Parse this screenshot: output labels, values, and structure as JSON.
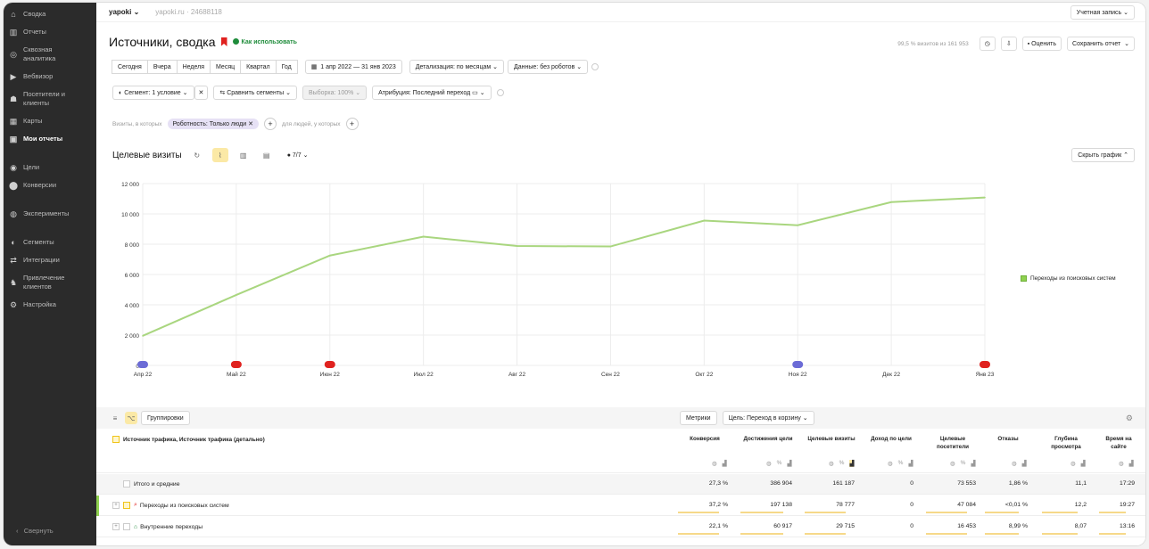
{
  "sidebar": {
    "items": [
      {
        "icon": "home-icon",
        "glyph": "⌂",
        "label": "Сводка"
      },
      {
        "icon": "reports-icon",
        "glyph": "▥",
        "label": "Отчеты"
      },
      {
        "icon": "endtoend-analytics-icon",
        "glyph": "◎",
        "label": "Сквозная аналитика"
      },
      {
        "icon": "webvisor-icon",
        "glyph": "▶",
        "label": "Вебвизор"
      },
      {
        "icon": "visitors-icon",
        "glyph": "☗",
        "label": "Посетители и клиенты"
      },
      {
        "icon": "maps-icon",
        "glyph": "▦",
        "label": "Карты"
      },
      {
        "icon": "my-reports-icon",
        "glyph": "▣",
        "label": "Мои отчеты"
      }
    ],
    "items2": [
      {
        "icon": "goals-icon",
        "glyph": "◉",
        "label": "Цели"
      },
      {
        "icon": "conversions-icon",
        "glyph": "⬤",
        "label": "Конверсии"
      }
    ],
    "items3": [
      {
        "icon": "experiments-icon",
        "glyph": "◍",
        "label": "Эксперименты"
      }
    ],
    "items4": [
      {
        "icon": "segments-icon",
        "glyph": "◐",
        "label": "Сегменты"
      },
      {
        "icon": "integrations-icon",
        "glyph": "⇄",
        "label": "Интеграции"
      },
      {
        "icon": "attract-clients-icon",
        "glyph": "♞",
        "label": "Привлечение клиентов"
      },
      {
        "icon": "settings-icon",
        "glyph": "⚙",
        "label": "Настройка"
      }
    ],
    "collapse": "Свернуть"
  },
  "topbar": {
    "site": "yapoki",
    "url": "yapoki.ru · 24688118",
    "account": "Учетная запись"
  },
  "header": {
    "title": "Источники, сводка",
    "howto": "Как использовать",
    "visits_note": "99,5 % визитов из 161 953",
    "rate": "Оценить",
    "save": "Сохранить отчет"
  },
  "periods": [
    "Сегодня",
    "Вчера",
    "Неделя",
    "Месяц",
    "Квартал",
    "Год"
  ],
  "date_range": "1 апр 2022 — 31 янв 2023",
  "detail": "Детализация: по месяцам",
  "data_filter": "Данные: без роботов",
  "filters": {
    "segment": "Сегмент: 1 условие",
    "compare": "Сравнить сегменты",
    "sample": "Выборка: 100%",
    "attribution": "Атрибуция: Последний переход"
  },
  "visits_filter": {
    "prefix": "Визиты, в которых",
    "chip": "Роботность: Только люди",
    "people": "для людей, у которых"
  },
  "chart_toolbar": {
    "title": "Целевые визиты",
    "count": "7/7",
    "hide": "Скрыть график"
  },
  "chart_data": {
    "type": "line",
    "title": "",
    "xlabel": "",
    "ylabel": "",
    "categories": [
      "Апр 22",
      "Май 22",
      "Июн 22",
      "Июл 22",
      "Авг 22",
      "Сен 22",
      "Окт 22",
      "Ноя 22",
      "Дек 22",
      "Янв 23"
    ],
    "series": [
      {
        "name": "Переходы из поисковых систем",
        "color": "#a9d67f",
        "values": [
          1950,
          4650,
          7250,
          8500,
          7880,
          7850,
          9560,
          9250,
          10780,
          11080
        ]
      }
    ],
    "ylim": [
      0,
      12000
    ],
    "yticks": [
      "0",
      "2 000",
      "4 000",
      "6 000",
      "8 000",
      "10 000",
      "12 000"
    ],
    "grid": true,
    "legend": "right"
  },
  "table_toolbar": {
    "groupings": "Группировки",
    "metrics": "Метрики",
    "goal": "Цель: Переход в корзину"
  },
  "table": {
    "dimension": "Источник трафика, Источник трафика (детально)",
    "columns": [
      "Конверсия",
      "Достижения цели",
      "Целевые визиты",
      "Доход по цели",
      "Целевые посетители",
      "Отказы",
      "Глубина просмотра",
      "Время на сайте"
    ],
    "rows": [
      {
        "label": "Итого и средние",
        "values": [
          "27,3 %",
          "386 904",
          "161 187",
          "0",
          "73 553",
          "1,86 %",
          "11,1",
          "17:29"
        ]
      },
      {
        "label": "Переходы из поисковых систем",
        "values": [
          "37,2 %",
          "197 138",
          "78 777",
          "0",
          "47 084",
          "<0,01 %",
          "12,2",
          "19:27"
        ]
      },
      {
        "label": "Внутренние переходы",
        "values": [
          "22,1 %",
          "60 917",
          "29 715",
          "0",
          "16 453",
          "8,99 %",
          "8,07",
          "13:16"
        ]
      }
    ]
  }
}
